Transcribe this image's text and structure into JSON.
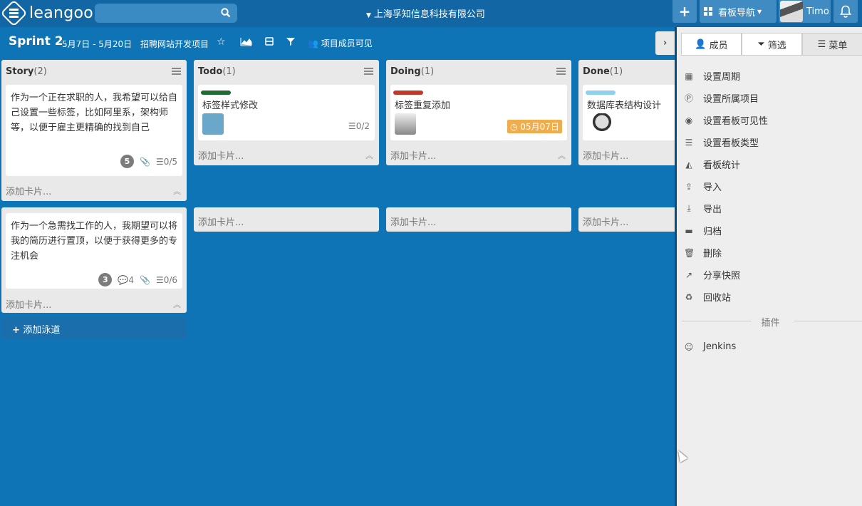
{
  "topbar": {
    "brand": "leangoo",
    "company": "上海孚知信息科技有限公司",
    "board_nav": "看板导航",
    "user": "Timo",
    "plus": "+"
  },
  "board": {
    "title": "Sprint 2",
    "dates": "5月7日 - 5月20日",
    "project": "招聘网站开发项目",
    "visibility": "项目成员可见"
  },
  "columns": [
    {
      "name": "Story",
      "count": "(2)"
    },
    {
      "name": "Todo",
      "count": "(1)"
    },
    {
      "name": "Doing",
      "count": "(1)"
    },
    {
      "name": "Done",
      "count": "(1)"
    }
  ],
  "cards": {
    "story1": {
      "text": "作为一个正在求职的人，我希望可以给自己设置一些标签，比如阿里系，架构师等，以便于雇主更精确的找到自己",
      "points": "5",
      "check": "0/5"
    },
    "story2": {
      "text": "作为一个急需找工作的人，我期望可以将我的简历进行置顶，以便于获得更多的专注机会",
      "points": "3",
      "comments": "4",
      "check": "0/6"
    },
    "todo": {
      "text": "标签样式修改",
      "check": "0/2",
      "label_color": "#1e6b33"
    },
    "doing": {
      "text": "标签重复添加",
      "date": "05月07日",
      "label_color": "#c0392b"
    },
    "done": {
      "text": "数据库表结构设计",
      "label_color": "#8fd0ee"
    }
  },
  "add_card": "添加卡片...",
  "add_lane": "添加泳道",
  "panel": {
    "tabs": [
      "成员",
      "筛选",
      "菜单"
    ],
    "items": [
      "设置周期",
      "设置所属项目",
      "设置看板可见性",
      "设置看板类型",
      "看板统计",
      "导入",
      "导出",
      "归档",
      "删除",
      "分享快照",
      "回收站"
    ],
    "plugins_label": "插件",
    "plugins": [
      "Jenkins"
    ]
  }
}
